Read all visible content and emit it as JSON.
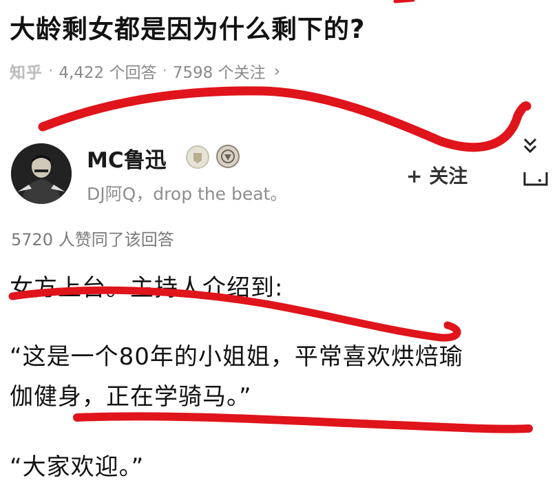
{
  "question": {
    "title": "大龄剩女都是因为什么剩下的?",
    "source": "知乎",
    "answers_count": "4,422 个回答",
    "followers_count": "7598 个关注",
    "separator": "·",
    "chevron": "›"
  },
  "author": {
    "name": "MC鲁迅",
    "bio": "DJ阿Q，drop the beat。",
    "follow_label": "+ 关注",
    "badges": [
      "medal-badge-icon",
      "achievement-badge-icon"
    ]
  },
  "answer": {
    "likes": "5720 人赞同了该回答",
    "paragraphs": [
      "女方上台。主持人介绍到:",
      "“这是一个80年的小姐姐，平常喜欢烘焙瑜",
      "伽健身，正在学骑马。”",
      "“大家欢迎。”"
    ]
  },
  "annotations": {
    "pen_color": "#e0141b",
    "strokes": 3
  }
}
